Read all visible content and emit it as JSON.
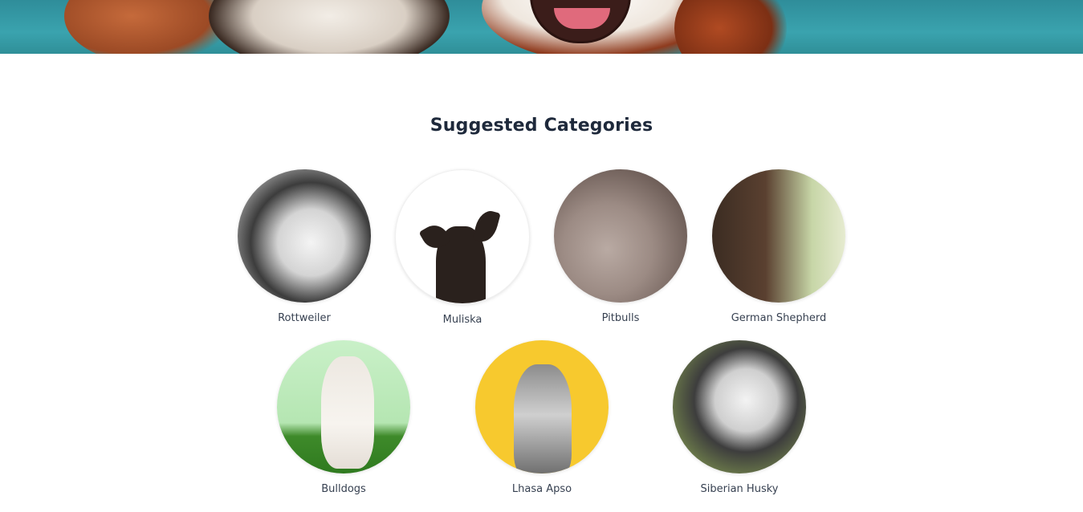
{
  "section": {
    "title": "Suggested Categories"
  },
  "categories": [
    {
      "label": "Rottweiler"
    },
    {
      "label": "Muliska"
    },
    {
      "label": "Pitbulls"
    },
    {
      "label": "German Shepherd"
    },
    {
      "label": "Bulldogs"
    },
    {
      "label": "Lhasa Apso"
    },
    {
      "label": "Siberian Husky"
    }
  ]
}
